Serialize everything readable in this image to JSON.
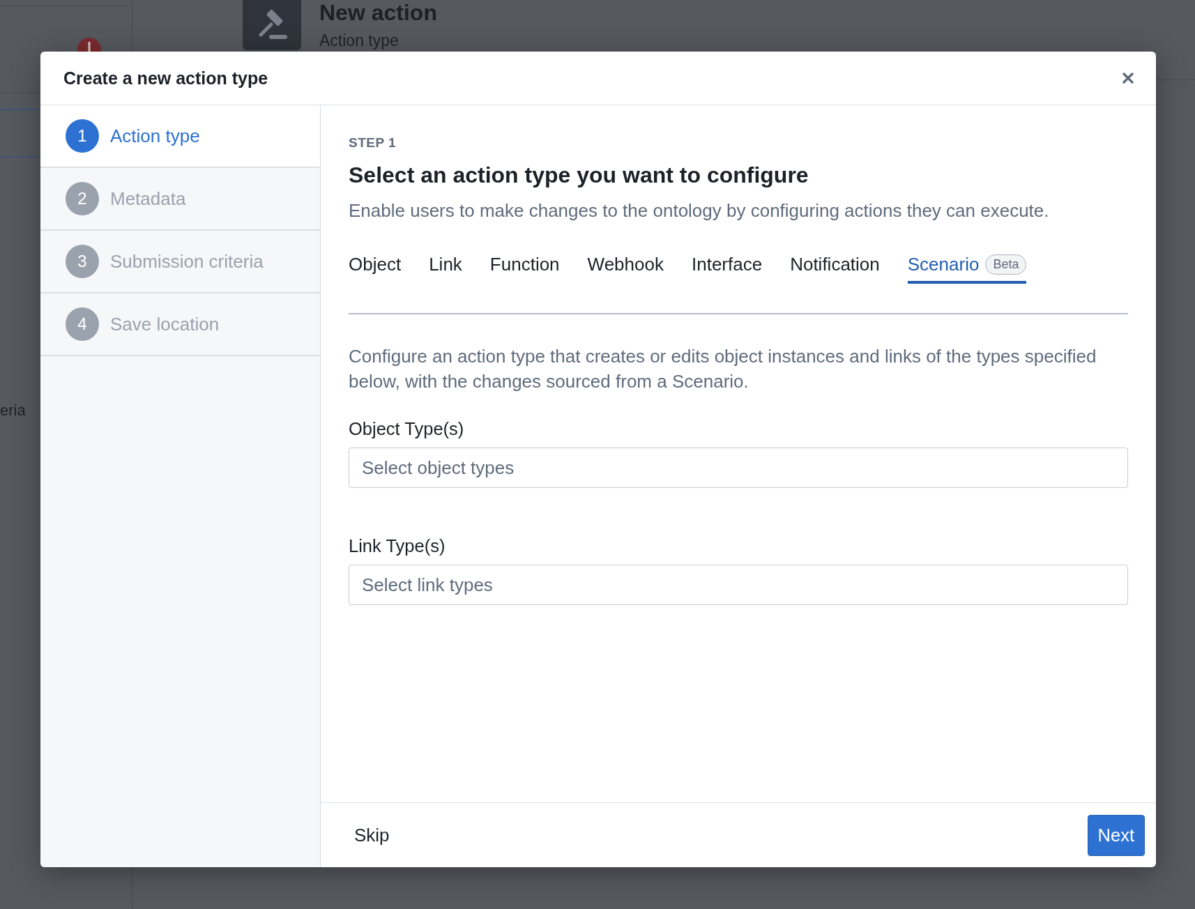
{
  "background": {
    "header": {
      "title": "New action",
      "subtitle": "Action type"
    },
    "sidebar_text": "eria"
  },
  "dialog": {
    "title": "Create a new action type",
    "steps": [
      {
        "number": "1",
        "label": "Action type",
        "selected": true
      },
      {
        "number": "2",
        "label": "Metadata",
        "selected": false
      },
      {
        "number": "3",
        "label": "Submission criteria",
        "selected": false
      },
      {
        "number": "4",
        "label": "Save location",
        "selected": false
      }
    ],
    "step_label": "STEP 1",
    "heading": "Select an action type you want to configure",
    "subheading": "Enable users to make changes to the ontology by configuring actions they can execute.",
    "tabs": [
      {
        "label": "Object",
        "selected": false
      },
      {
        "label": "Link",
        "selected": false
      },
      {
        "label": "Function",
        "selected": false
      },
      {
        "label": "Webhook",
        "selected": false
      },
      {
        "label": "Interface",
        "selected": false
      },
      {
        "label": "Notification",
        "selected": false
      },
      {
        "label": "Scenario",
        "selected": true,
        "badge": "Beta"
      }
    ],
    "description": "Configure an action type that creates or edits object instances and links of the types specified below, with the changes sourced from a Scenario.",
    "fields": [
      {
        "label": "Object Type(s)",
        "placeholder": "Select object types"
      },
      {
        "label": "Link Type(s)",
        "placeholder": "Select link types"
      }
    ],
    "footer": {
      "secondary_button": "Skip",
      "primary_button": "Next"
    }
  }
}
